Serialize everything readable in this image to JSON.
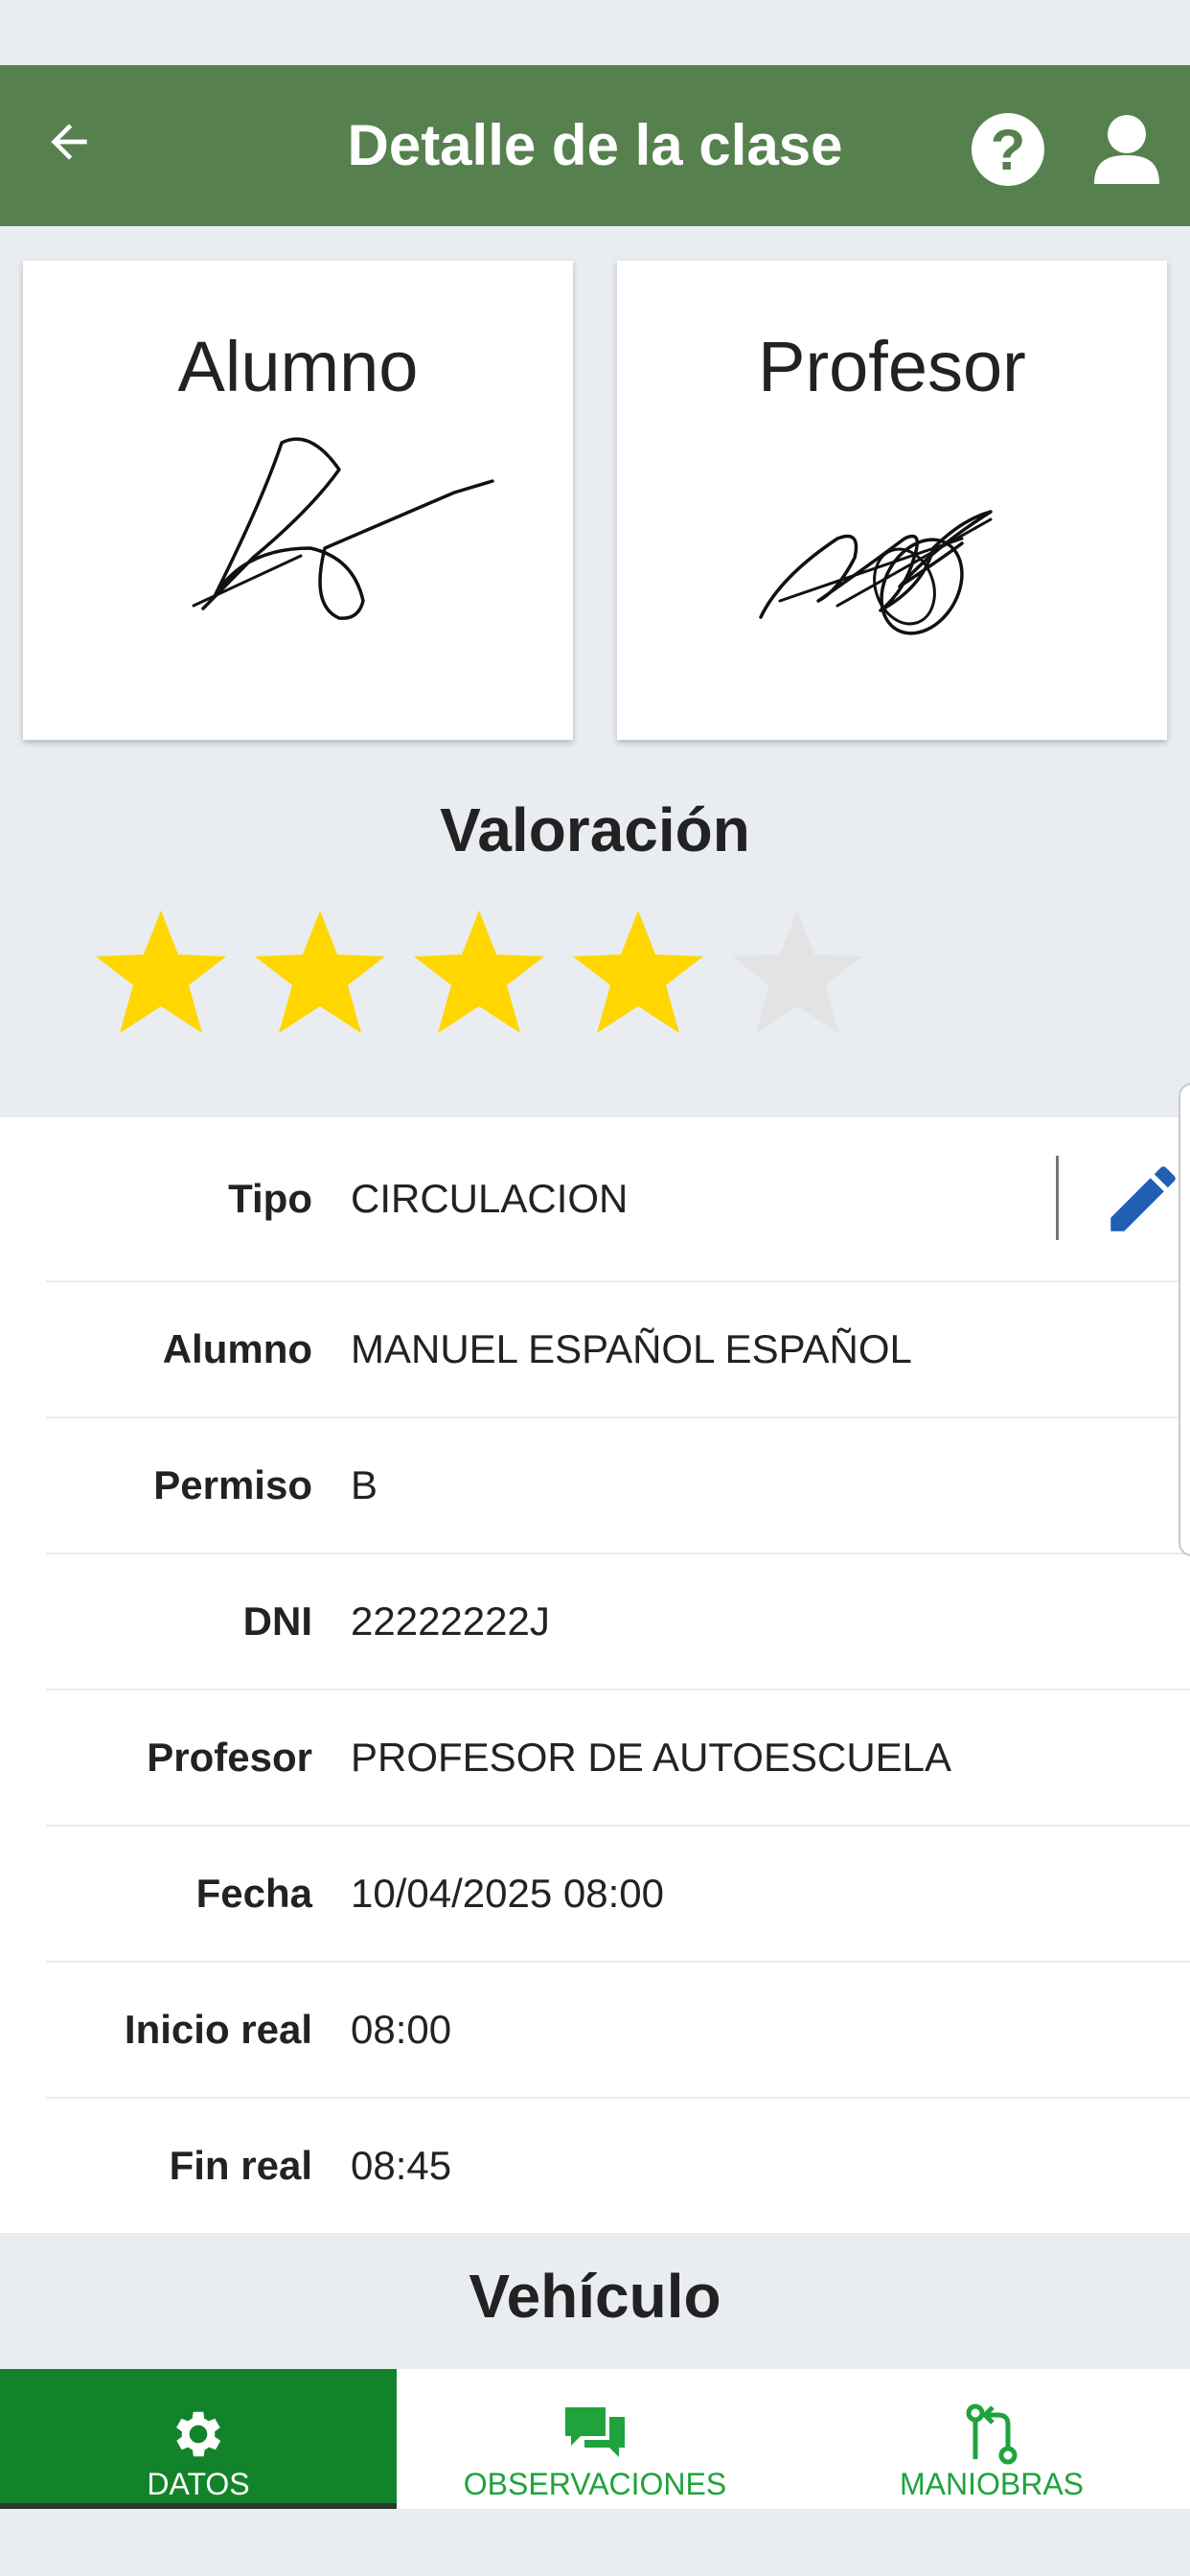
{
  "header": {
    "title": "Detalle de la clase",
    "back_icon": "arrow-left-icon",
    "help_label": "?",
    "help_icon": "question-circle-icon",
    "user_icon": "user-icon",
    "color": "#56814f"
  },
  "signatures": {
    "alumno_title": "Alumno",
    "profesor_title": "Profesor"
  },
  "rating": {
    "title": "Valoración",
    "value": 4,
    "max": 5,
    "filled_color": "#ffd600",
    "empty_color": "#e3e3e3"
  },
  "details": {
    "rows": [
      {
        "label": "Tipo",
        "value": "CIRCULACION"
      },
      {
        "label": "Alumno",
        "value": "MANUEL ESPAÑOL ESPAÑOL"
      },
      {
        "label": "Permiso",
        "value": "B"
      },
      {
        "label": "DNI",
        "value": "22222222J"
      },
      {
        "label": "Profesor",
        "value": "PROFESOR DE AUTOESCUELA"
      },
      {
        "label": "Fecha",
        "value": "10/04/2025 08:00"
      },
      {
        "label": "Inicio real",
        "value": "08:00"
      },
      {
        "label": "Fin real",
        "value": "08:45"
      }
    ],
    "edit_icon": "pencil-icon",
    "edit_color": "#1f5fb4"
  },
  "vehicle_section": {
    "title": "Vehículo"
  },
  "tabs": [
    {
      "label": "DATOS",
      "icon": "gear-icon",
      "active": true
    },
    {
      "label": "OBSERVACIONES",
      "icon": "chat-icon",
      "active": false
    },
    {
      "label": "MANIOBRAS",
      "icon": "route-icon",
      "active": false
    }
  ],
  "tab_active_color": "#12832a"
}
